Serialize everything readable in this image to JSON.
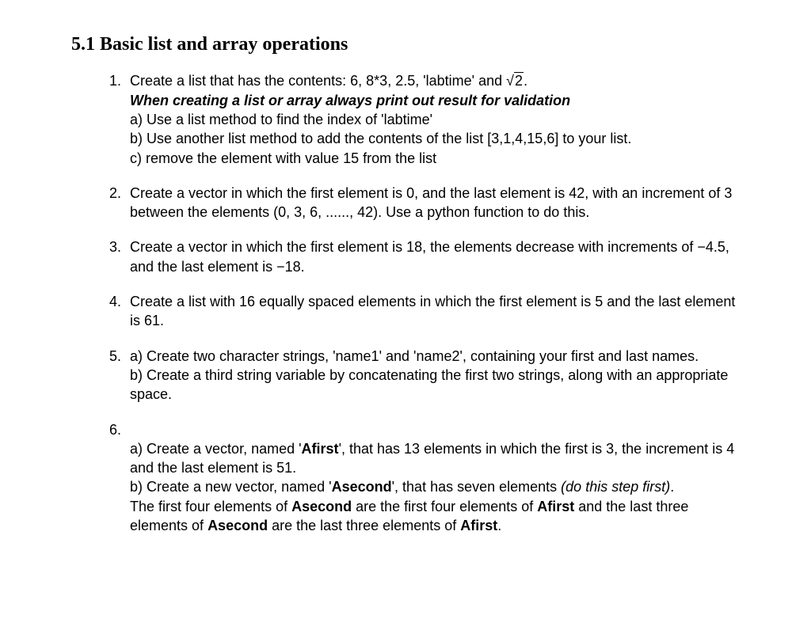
{
  "heading": "5.1 Basic list and array operations",
  "items": {
    "i1": {
      "l1a": "Create a list that has the contents: 6, 8*3, 2.5, 'labtime' and ",
      "sqrt": "2",
      "l1b": ".",
      "l2": "When creating a list or array always print out result for validation",
      "a": "a) Use a list method to find the index of 'labtime'",
      "b": "b) Use another list method to add the contents of the list [3,1,4,15,6] to your list.",
      "c": "c) remove the element with value 15 from the list"
    },
    "i2": "Create a vector in which the first element is 0, and the last element is 42, with an increment of 3 between the elements (0, 3, 6, ......, 42). Use a python function to do this.",
    "i3": "Create a vector in which the first element is 18, the elements decrease with increments of −4.5, and the last element is −18.",
    "i4": "Create a list with 16 equally spaced elements in which the first element is 5 and the last element is 61.",
    "i5": {
      "a": "a) Create two character strings, 'name1' and 'name2', containing your first and last names.",
      "b": "b) Create a third string variable by concatenating the first two strings, along with an appropriate space."
    },
    "i6": {
      "a1": "a) Create a vector, named '",
      "afirst": "Afirst",
      "a2": "', that has 13 elements in which the first is 3, the increment is 4 and the last element is 51.",
      "b1": "b) Create a new vector, named '",
      "asecond": "Asecond",
      "b2": "', that has seven elements ",
      "bstep": "(do this step first)",
      "b3": ".",
      "c1": "The first four elements of ",
      "c2": " are the first four elements of ",
      "c3": " and the last three elements of ",
      "c4": " are the last three elements of ",
      "c5": "."
    }
  }
}
